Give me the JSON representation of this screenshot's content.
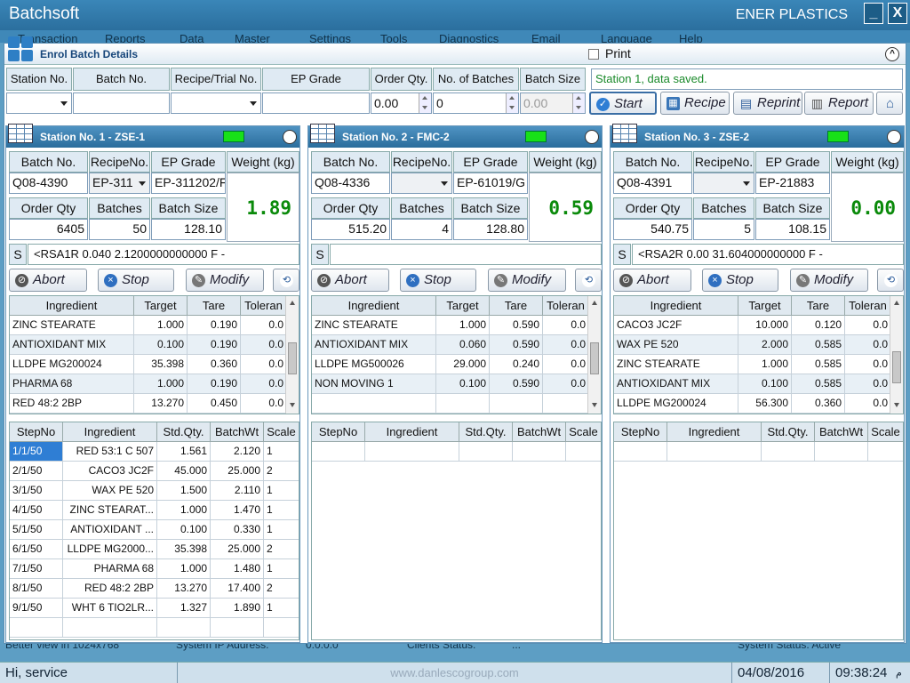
{
  "app": {
    "title": "Batchsoft",
    "company": "ENER PLASTICS",
    "minimize": "_",
    "close": "X"
  },
  "menu": [
    "Transaction",
    "Reports",
    "Data",
    "Master",
    "Settings",
    "Tools",
    "Diagnostics",
    "Email",
    "Language",
    "Help"
  ],
  "window": {
    "title": "Enrol Batch Details",
    "print_label": "Print",
    "collapse": "^"
  },
  "enrol": {
    "headers": [
      "Station No.",
      "Batch No.",
      "Recipe/Trial No.",
      "EP Grade",
      "Order Qty.",
      "No. of Batches",
      "Batch Size"
    ],
    "values": {
      "station": "",
      "batch": "",
      "recipe": "",
      "ep_grade": "",
      "order_qty": "0.00",
      "batches": "0",
      "batch_size": "0.00"
    },
    "message": "Station 1, data saved.",
    "buttons": {
      "start": "Start",
      "recipe": "Recipe",
      "reprint": "Reprint",
      "report": "Report"
    }
  },
  "stations": [
    {
      "title": "Station No. 1 - ZSE-1",
      "batch_no": "Q08-4390",
      "recipe_no": "EP-311",
      "ep_grade": "EP-311202/F",
      "order_qty": "6405",
      "batches": "50",
      "batch_size": "128.10",
      "weight": "1.89",
      "s_label": "S",
      "s_text": "<RSA1R 0.040 2.1200000000000 F  -",
      "labels": {
        "batch_no": "Batch No.",
        "recipe_no": "RecipeNo.",
        "ep_grade": "EP Grade",
        "weight": "Weight (kg)",
        "order_qty": "Order Qty",
        "batches": "Batches",
        "batch_size": "Batch Size"
      },
      "buttons": {
        "abort": "Abort",
        "stop": "Stop",
        "modify": "Modify"
      },
      "ingr_headers": [
        "Ingredient",
        "Target",
        "Tare",
        "Toleran"
      ],
      "ingredients": [
        [
          "ZINC STEARATE",
          "1.000",
          "0.190",
          "0.0"
        ],
        [
          "ANTIOXIDANT MIX",
          "0.100",
          "0.190",
          "0.0"
        ],
        [
          "LLDPE MG200024",
          "35.398",
          "0.360",
          "0.0"
        ],
        [
          "PHARMA 68",
          "1.000",
          "0.190",
          "0.0"
        ],
        [
          "RED 48:2 2BP",
          "13.270",
          "0.450",
          "0.0"
        ]
      ],
      "step_headers": [
        "StepNo",
        "Ingredient",
        "Std.Qty.",
        "BatchWt",
        "Scale"
      ],
      "steps": [
        [
          "1/1/50",
          "RED 53:1 C 507",
          "1.561",
          "2.120",
          "1"
        ],
        [
          "2/1/50",
          "CACO3 JC2F",
          "45.000",
          "25.000",
          "2"
        ],
        [
          "3/1/50",
          "WAX PE 520",
          "1.500",
          "2.110",
          "1"
        ],
        [
          "4/1/50",
          "ZINC STEARAT...",
          "1.000",
          "1.470",
          "1"
        ],
        [
          "5/1/50",
          "ANTIOXIDANT ...",
          "0.100",
          "0.330",
          "1"
        ],
        [
          "6/1/50",
          "LLDPE MG2000...",
          "35.398",
          "25.000",
          "2"
        ],
        [
          "7/1/50",
          "PHARMA 68",
          "1.000",
          "1.480",
          "1"
        ],
        [
          "8/1/50",
          "RED 48:2 2BP",
          "13.270",
          "17.400",
          "2"
        ],
        [
          "9/1/50",
          "WHT 6 TIO2LR...",
          "1.327",
          "1.890",
          "1"
        ]
      ]
    },
    {
      "title": "Station No. 2 - FMC-2",
      "batch_no": "Q08-4336",
      "recipe_no": "",
      "ep_grade": "EP-61019/G",
      "order_qty": "515.20",
      "batches": "4",
      "batch_size": "128.80",
      "weight": "0.59",
      "s_label": "S",
      "s_text": "",
      "labels": {
        "batch_no": "Batch No.",
        "recipe_no": "RecipeNo.",
        "ep_grade": "EP Grade",
        "weight": "Weight (kg)",
        "order_qty": "Order Qty",
        "batches": "Batches",
        "batch_size": "Batch Size"
      },
      "buttons": {
        "abort": "Abort",
        "stop": "Stop",
        "modify": "Modify"
      },
      "ingr_headers": [
        "Ingredient",
        "Target",
        "Tare",
        "Toleran"
      ],
      "ingredients": [
        [
          "ZINC STEARATE",
          "1.000",
          "0.590",
          "0.0"
        ],
        [
          "ANTIOXIDANT MIX",
          "0.060",
          "0.590",
          "0.0"
        ],
        [
          "LLDPE MG500026",
          "29.000",
          "0.240",
          "0.0"
        ],
        [
          "NON MOVING 1",
          "0.100",
          "0.590",
          "0.0"
        ]
      ],
      "step_headers": [
        "StepNo",
        "Ingredient",
        "Std.Qty.",
        "BatchWt",
        "Scale"
      ],
      "steps": []
    },
    {
      "title": "Station No. 3 - ZSE-2",
      "batch_no": "Q08-4391",
      "recipe_no": "",
      "ep_grade": "EP-21883",
      "order_qty": "540.75",
      "batches": "5",
      "batch_size": "108.15",
      "weight": "0.00",
      "s_label": "S",
      "s_text": "<RSA2R  0.00 31.604000000000 F  -",
      "labels": {
        "batch_no": "Batch No.",
        "recipe_no": "RecipeNo.",
        "ep_grade": "EP Grade",
        "weight": "Weight (kg)",
        "order_qty": "Order Qty",
        "batches": "Batches",
        "batch_size": "Batch Size"
      },
      "buttons": {
        "abort": "Abort",
        "stop": "Stop",
        "modify": "Modify"
      },
      "ingr_headers": [
        "Ingredient",
        "Target",
        "Tare",
        "Toleran"
      ],
      "ingredients": [
        [
          "CACO3 JC2F",
          "10.000",
          "0.120",
          "0.0"
        ],
        [
          "WAX PE 520",
          "2.000",
          "0.585",
          "0.0"
        ],
        [
          "ZINC STEARATE",
          "1.000",
          "0.585",
          "0.0"
        ],
        [
          "ANTIOXIDANT MIX",
          "0.100",
          "0.585",
          "0.0"
        ],
        [
          "LLDPE MG200024",
          "56.300",
          "0.360",
          "0.0"
        ]
      ],
      "step_headers": [
        "StepNo",
        "Ingredient",
        "Std.Qty.",
        "BatchWt",
        "Scale"
      ],
      "steps": []
    }
  ],
  "background": {
    "view_text": "Better view in 1024x768",
    "ip_text": "System IP Address:",
    "ip_value": "0.0.0.0",
    "clients_text": "Clients Status:",
    "clients_value": "...",
    "system_text": "System Status: Active"
  },
  "status": {
    "user": "Hi, service",
    "website": "www.danlescogroup.com",
    "date": "04/08/2016",
    "time": "09:38:24",
    "ampm": "م"
  },
  "colors": {
    "accent": "#2b6f9e",
    "led": "#18e018",
    "weight": "#0a8a0a",
    "message": "#1a8a2a"
  }
}
